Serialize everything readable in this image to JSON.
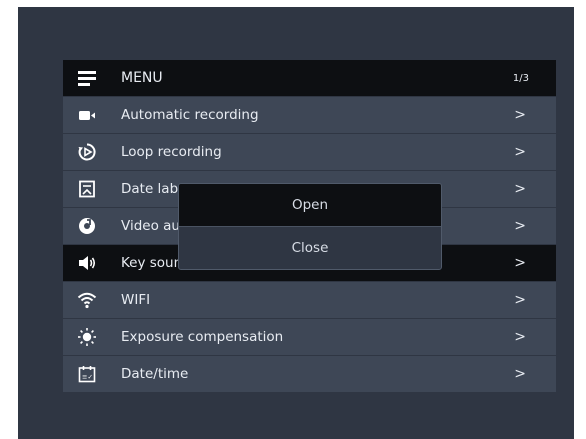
{
  "header": {
    "title": "MENU",
    "page": "1/3",
    "icon": "menu-icon"
  },
  "items": [
    {
      "label": "Automatic recording",
      "icon": "video-camera-icon",
      "chevron": ">"
    },
    {
      "label": "Loop recording",
      "icon": "loop-icon",
      "chevron": ">"
    },
    {
      "label": "Date label",
      "icon": "label-icon",
      "chevron": ">"
    },
    {
      "label": "Video audio",
      "icon": "audio-disc-icon",
      "chevron": ">"
    },
    {
      "label": "Key sound",
      "icon": "speaker-icon",
      "chevron": ">"
    },
    {
      "label": "WIFI",
      "icon": "wifi-icon",
      "chevron": ">"
    },
    {
      "label": "Exposure compensation",
      "icon": "brightness-icon",
      "chevron": ">"
    },
    {
      "label": "Date/time",
      "icon": "calendar-icon",
      "chevron": ">"
    }
  ],
  "selected_index": 4,
  "popup": {
    "options": [
      "Open",
      "Close"
    ],
    "highlighted": "Open"
  },
  "colors": {
    "screen_bg": "#2f3643",
    "row_bg": "#3e4756",
    "selected_bg": "#0d0f12",
    "text": "#e8ecf2"
  }
}
